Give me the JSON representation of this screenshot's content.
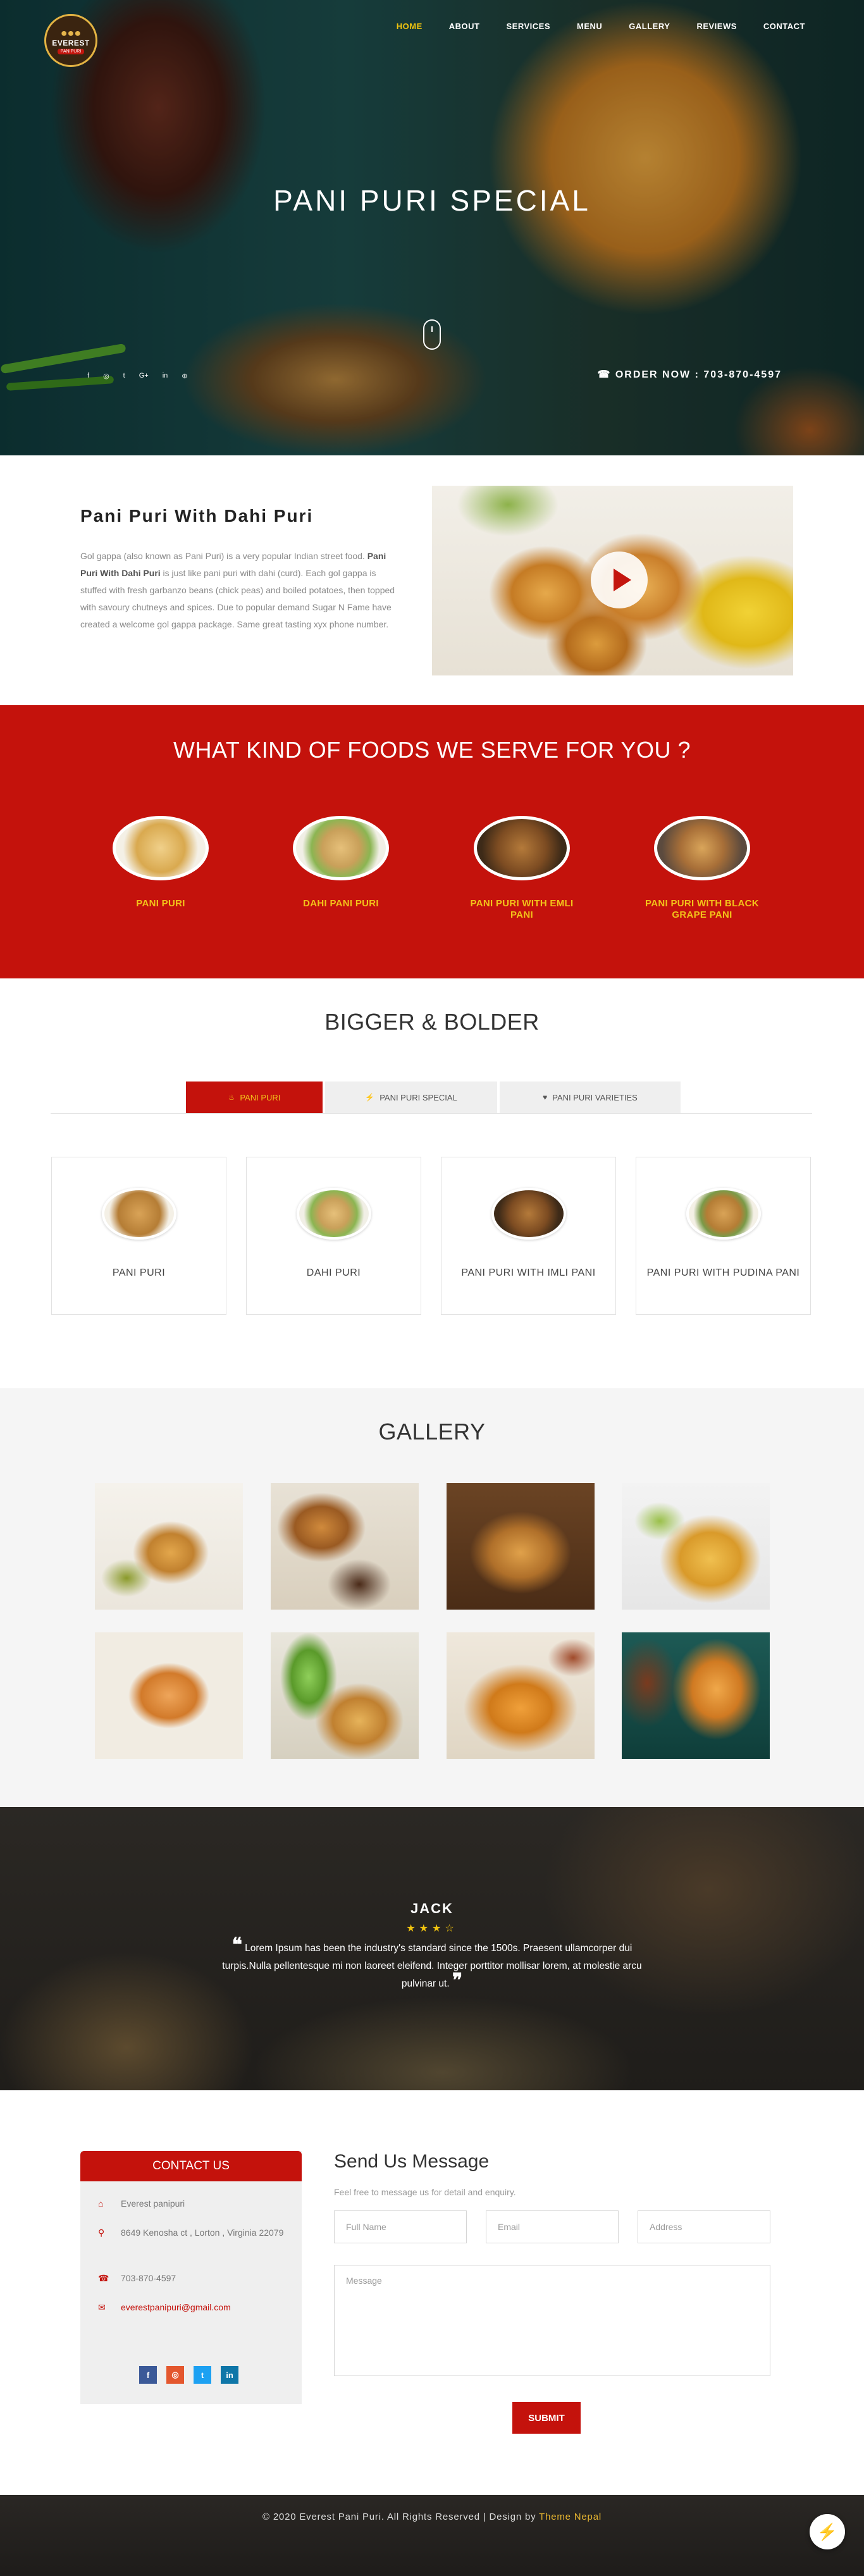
{
  "brand": {
    "name": "EVEREST",
    "sub": "PANIPURI"
  },
  "nav": [
    "HOME",
    "ABOUT",
    "SERVICES",
    "MENU",
    "GALLERY",
    "REVIEWS",
    "CONTACT"
  ],
  "hero": {
    "title": "PANI PURI SPECIAL",
    "socials": [
      "f",
      "◎",
      "t",
      "G+",
      "in",
      "⊕"
    ],
    "order": "☎ ORDER NOW : 703-870-4597"
  },
  "about": {
    "title": "Pani Puri With Dahi Puri",
    "text_a": "Gol gappa (also known as Pani Puri) is a very popular Indian street food.",
    "text_bold": "Pani Puri With Dahi Puri",
    "text_b": "is just like pani puri with dahi (curd). Each gol gappa is stuffed with fresh garbanzo beans (chick peas) and boiled potatoes, then topped with savoury chutneys and spices. Due to popular demand Sugar N Fame have created a welcome gol gappa package. Same great tasting xyx phone number."
  },
  "serve": {
    "title": "WHAT KIND OF FOODS WE SERVE FOR YOU ?",
    "items": [
      {
        "label": "PANI PURI"
      },
      {
        "label": "DAHI PANI PURI"
      },
      {
        "label": "PANI PURI WITH EMLI PANI"
      },
      {
        "label": "PANI PURI WITH BLACK GRAPE PANI"
      }
    ]
  },
  "bigger": {
    "title": "BIGGER & BOLDER",
    "tabs": [
      {
        "label": "PANI PURI",
        "icon": "♨"
      },
      {
        "label": "PANI PURI SPECIAL",
        "icon": "⚡"
      },
      {
        "label": "PANI PURI VARIETIES",
        "icon": "♥"
      }
    ],
    "cards": [
      "PANI PURI",
      "DAHI PURI",
      "PANI PURI WITH IMLI PANI",
      "PANI PURI WITH PUDINA PANI"
    ]
  },
  "gallery": {
    "title": "GALLERY"
  },
  "testimonial": {
    "name": "JACK",
    "stars": "★★★☆",
    "quote": "Lorem Ipsum has been the industry's standard since the 1500s. Praesent ullamcorper dui turpis.Nulla pellentesque mi non laoreet eleifend. Integer porttitor mollisar lorem, at molestie arcu pulvinar ut."
  },
  "contact": {
    "title": "CONTACT US",
    "name": "Everest panipuri",
    "address": "8649 Kenosha ct , Lorton , Virginia 22079",
    "phone": "703-870-4597",
    "email": "everestpanipuri@gmail.com",
    "social": [
      "f",
      "◎",
      "t",
      "in"
    ]
  },
  "form": {
    "title": "Send Us Message",
    "subtitle": "Feel free to message us for detail and enquiry.",
    "fullname": "Full Name",
    "email": "Email",
    "address": "Address",
    "message": "Message",
    "submit": "SUBMIT"
  },
  "footer": {
    "text": "© 2020 Everest Pani Puri. All Rights Reserved | Design by",
    "link": "Theme Nepal"
  },
  "colors": {
    "primary": "#c4120c",
    "accent": "#f2c21a"
  }
}
